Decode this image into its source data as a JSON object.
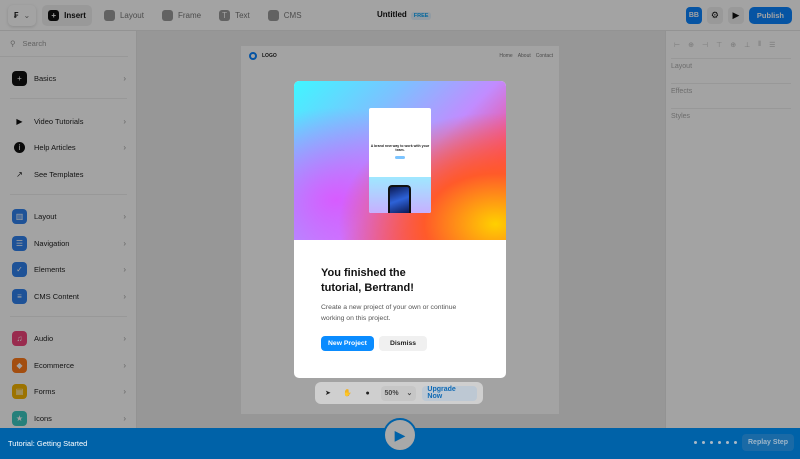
{
  "toolbar": {
    "tabs": [
      {
        "label": "Insert"
      },
      {
        "label": "Layout"
      },
      {
        "label": "Frame"
      },
      {
        "label": "Text"
      },
      {
        "label": "CMS"
      }
    ],
    "title": "Untitled",
    "badge": "FREE",
    "avatar": "BB",
    "publish": "Publish"
  },
  "sidebar": {
    "search_placeholder": "Search",
    "items": [
      {
        "label": "Basics",
        "color": "#111111"
      },
      {
        "label": "Video Tutorials"
      },
      {
        "label": "Help Articles"
      },
      {
        "label": "See Templates"
      },
      {
        "label": "Layout",
        "color": "#2f80ed"
      },
      {
        "label": "Navigation",
        "color": "#2f80ed"
      },
      {
        "label": "Elements",
        "color": "#2f80ed"
      },
      {
        "label": "CMS Content",
        "color": "#2f80ed"
      },
      {
        "label": "Audio",
        "color": "#f0447a"
      },
      {
        "label": "Ecommerce",
        "color": "#ff7a1a"
      },
      {
        "label": "Forms",
        "color": "#f5b400"
      },
      {
        "label": "Icons",
        "color": "#3cc9c0"
      }
    ]
  },
  "page": {
    "logo": "LOGO",
    "nav": [
      "Home",
      "About",
      "Contact"
    ]
  },
  "right_panel": {
    "sections": [
      "Layout",
      "Effects",
      "Styles"
    ]
  },
  "modal": {
    "hero_text": "A brand new way to work with your team.",
    "title": "You finished the tutorial, Bertrand!",
    "body": "Create a new project of your own or continue working on this project.",
    "primary": "New Project",
    "secondary": "Dismiss"
  },
  "canvas_tools": {
    "zoom": "50%",
    "upgrade": "Upgrade Now"
  },
  "tutorial": {
    "label": "Tutorial: Getting Started",
    "steps": 6,
    "replay": "Replay Step"
  }
}
